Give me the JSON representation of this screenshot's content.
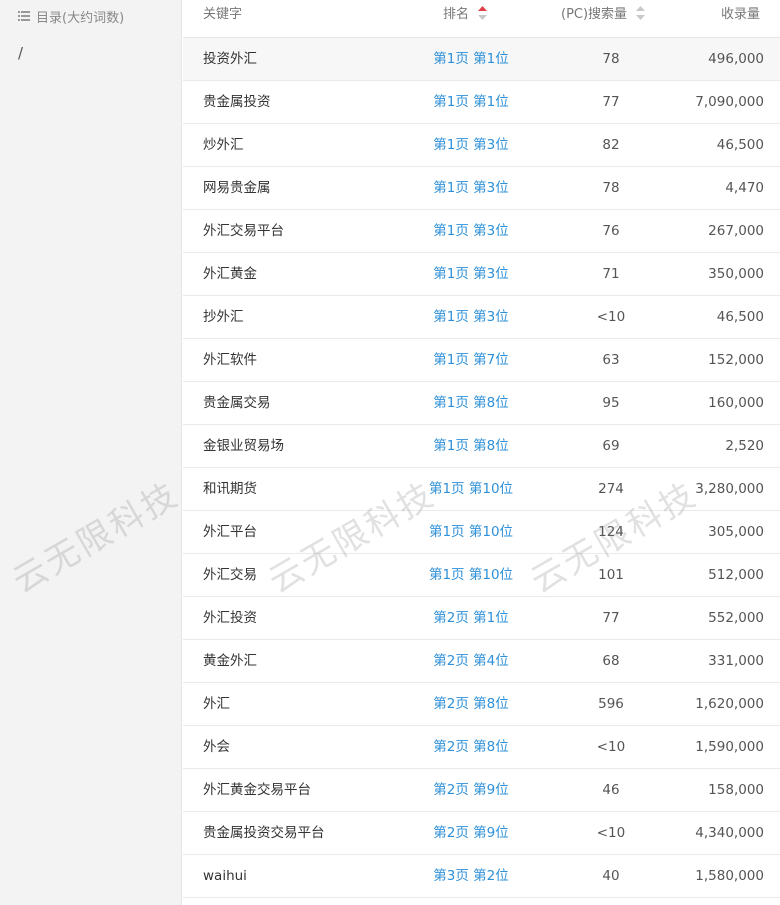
{
  "sidebar": {
    "header_label": "目录(大约词数)",
    "path": "/"
  },
  "table": {
    "headers": {
      "keyword": "关键字",
      "rank": "排名",
      "search_volume": "(PC)搜索量",
      "indexed": "收录量"
    },
    "rows": [
      {
        "keyword": "投资外汇",
        "rank": "第1页 第1位",
        "search": "78",
        "indexed": "496,000"
      },
      {
        "keyword": "贵金属投资",
        "rank": "第1页 第1位",
        "search": "77",
        "indexed": "7,090,000"
      },
      {
        "keyword": "炒外汇",
        "rank": "第1页 第3位",
        "search": "82",
        "indexed": "46,500"
      },
      {
        "keyword": "网易贵金属",
        "rank": "第1页 第3位",
        "search": "78",
        "indexed": "4,470"
      },
      {
        "keyword": "外汇交易平台",
        "rank": "第1页 第3位",
        "search": "76",
        "indexed": "267,000"
      },
      {
        "keyword": "外汇黄金",
        "rank": "第1页 第3位",
        "search": "71",
        "indexed": "350,000"
      },
      {
        "keyword": "抄外汇",
        "rank": "第1页 第3位",
        "search": "<10",
        "indexed": "46,500"
      },
      {
        "keyword": "外汇软件",
        "rank": "第1页 第7位",
        "search": "63",
        "indexed": "152,000"
      },
      {
        "keyword": "贵金属交易",
        "rank": "第1页 第8位",
        "search": "95",
        "indexed": "160,000"
      },
      {
        "keyword": "金银业贸易场",
        "rank": "第1页 第8位",
        "search": "69",
        "indexed": "2,520"
      },
      {
        "keyword": "和讯期货",
        "rank": "第1页 第10位",
        "search": "274",
        "indexed": "3,280,000"
      },
      {
        "keyword": "外汇平台",
        "rank": "第1页 第10位",
        "search": "124",
        "indexed": "305,000"
      },
      {
        "keyword": "外汇交易",
        "rank": "第1页 第10位",
        "search": "101",
        "indexed": "512,000"
      },
      {
        "keyword": "外汇投资",
        "rank": "第2页 第1位",
        "search": "77",
        "indexed": "552,000"
      },
      {
        "keyword": "黄金外汇",
        "rank": "第2页 第4位",
        "search": "68",
        "indexed": "331,000"
      },
      {
        "keyword": "外汇",
        "rank": "第2页 第8位",
        "search": "596",
        "indexed": "1,620,000"
      },
      {
        "keyword": "外会",
        "rank": "第2页 第8位",
        "search": "<10",
        "indexed": "1,590,000"
      },
      {
        "keyword": "外汇黄金交易平台",
        "rank": "第2页 第9位",
        "search": "46",
        "indexed": "158,000"
      },
      {
        "keyword": "贵金属投资交易平台",
        "rank": "第2页 第9位",
        "search": "<10",
        "indexed": "4,340,000"
      },
      {
        "keyword": "waihui",
        "rank": "第3页 第2位",
        "search": "40",
        "indexed": "1,580,000"
      }
    ]
  },
  "watermark": "云无限科技",
  "colors": {
    "link_blue": "#2e90d9",
    "sort_active_red": "#e0404a",
    "sort_inactive_gray": "#c8c8c8",
    "sidebar_bg": "#f3f3f3"
  }
}
